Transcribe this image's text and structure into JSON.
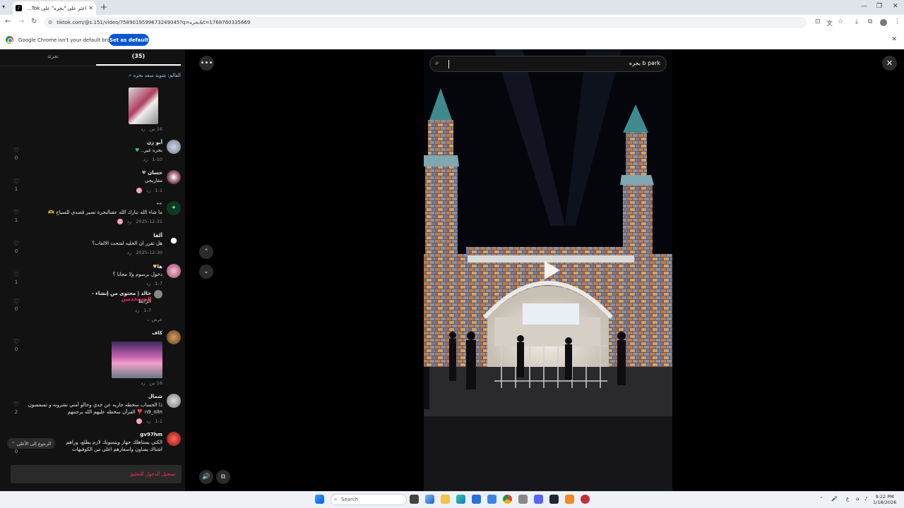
{
  "browser": {
    "tab_title": "اعثر على \"بحره\" على TikTok | بحث",
    "tab_favicon": "tiktok-icon",
    "new_tab": "+",
    "url": "tiktok.com/@s.151/video/7589019599673249045?q=بحره&t=1768760335669",
    "infobar_text": "Google Chrome isn't your default browser",
    "set_default_label": "Set as default"
  },
  "panel": {
    "tab_comments": "(35)",
    "tab_related": "نجزئة",
    "pinned": "العالم: شوية سعد بحره",
    "back_to_top": "الرجوع إلى الأعلى",
    "login_prompt": "تسجيل الدخول للتعليق",
    "reply_label": "رد",
    "comments": [
      {
        "user": "",
        "text": "",
        "meta": "16 س",
        "likes": ""
      },
      {
        "user": "أبو زن",
        "text": "بحره غير..",
        "meta": "1-10",
        "likes": "0"
      },
      {
        "user": "حسان",
        "text": "مقاريجي",
        "meta": "1-1",
        "likes": "1"
      },
      {
        "user": "👓",
        "text": "ما شاء الله تبارك الله عقبالبحرة تصير قصدي للسياح",
        "meta": "2025-12-31",
        "likes": "1"
      },
      {
        "user": "ألفا",
        "text": "هل تقرر ان الخليه لفتحت الالعاب؟",
        "meta": "2025-12-30",
        "likes": "0"
      },
      {
        "user": "ها",
        "text": "دخول برسوم ولا مجانا ؟",
        "meta": "1-7",
        "likes": "1"
      },
      {
        "user": "خالد | محتوى من إنشاء -",
        "user_tag": "المستخدمين",
        "text": "الرابط",
        "meta": "1-7",
        "likes": "0",
        "more": "عرض"
      },
      {
        "user": "كاف",
        "text": "",
        "meta": "16 س",
        "likes": "0"
      },
      {
        "user": "شمال",
        "text": "ذا الحساب سخطه جاريه عن جدي وخالو أمتي نشرونه و تسمسون n9_nlln ❣️ القرآن سخطه عليهم الله يرحمهم",
        "meta": "1-1",
        "likes": "2"
      },
      {
        "user": "gv97hm",
        "text": "الكتي يستاهلك جهاز ويتمنونك لازم يطلع، وراهم اشتاك يساون واسعارهم اغلى من الكوفيهات",
        "meta": "",
        "likes": "0"
      }
    ]
  },
  "video": {
    "search_query": "b park بحره",
    "play_icon": "play-icon"
  },
  "taskbar": {
    "search_label": "Search",
    "time": "9:22 PM",
    "date": "1/18/2026"
  },
  "colors": {
    "accent_red": "#fe2c55",
    "chrome_blue": "#0b57d0",
    "panel_bg": "#121212"
  }
}
